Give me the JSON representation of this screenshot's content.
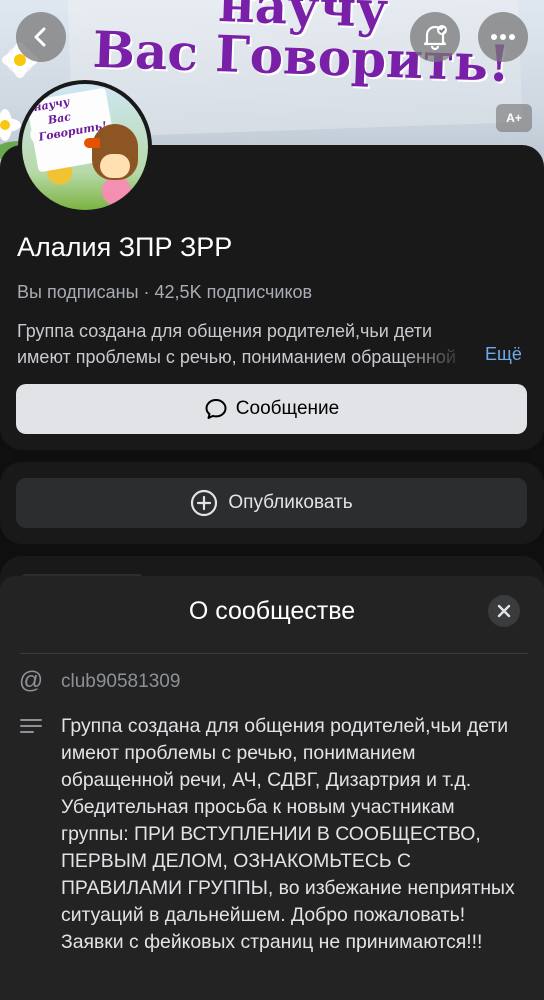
{
  "cover": {
    "title_line1": "научу",
    "title_line2": "Вас Говорить!",
    "aplus_label": "А+"
  },
  "avatar": {
    "lines": [
      "научу",
      "Вас",
      "Говорить!"
    ]
  },
  "group": {
    "name": "Алалия ЗПР  ЗРР",
    "subscribed": "Вы подписаны",
    "separator": "·",
    "subscribers": "42,5K подписчиков",
    "short_description": "Группа создана для общения родителей,чьи дети имеют проблемы с речью, пониманием обращенной речи",
    "more_label": "Ещё"
  },
  "buttons": {
    "message_label": "Сообщение",
    "publish_label": "Опубликовать"
  },
  "sheet": {
    "title": "О сообществе",
    "club_id": "club90581309",
    "about": "Группа создана для общения родителей,чьи дети имеют проблемы с речью, пониманием обращенной речи, АЧ, СДВГ, Дизартрия и т.д. Убедительная просьба к новым участникам группы: ПРИ ВСТУПЛЕНИИ В СООБЩЕСТВО, ПЕРВЫМ ДЕЛОМ, ОЗНАКОМЬТЕСЬ С ПРАВИЛАМИ ГРУППЫ, во избежание неприятных ситуаций в дальнейшем. Добро пожаловать! Заявки с фейковых страниц не принимаются!!!"
  },
  "icons": {
    "back": "chevron-left-icon",
    "notify": "bell-check-icon",
    "more": "more-horizontal-icon",
    "message": "message-bubble-icon",
    "publish": "plus-circle-icon",
    "close": "close-icon",
    "at": "at-icon",
    "text": "text-lines-icon"
  },
  "colors": {
    "background": "#0f0f0f",
    "card": "#191919",
    "sheet": "#232324",
    "accent_link": "#71aaeb",
    "cover_title": "#7a1fa8"
  }
}
